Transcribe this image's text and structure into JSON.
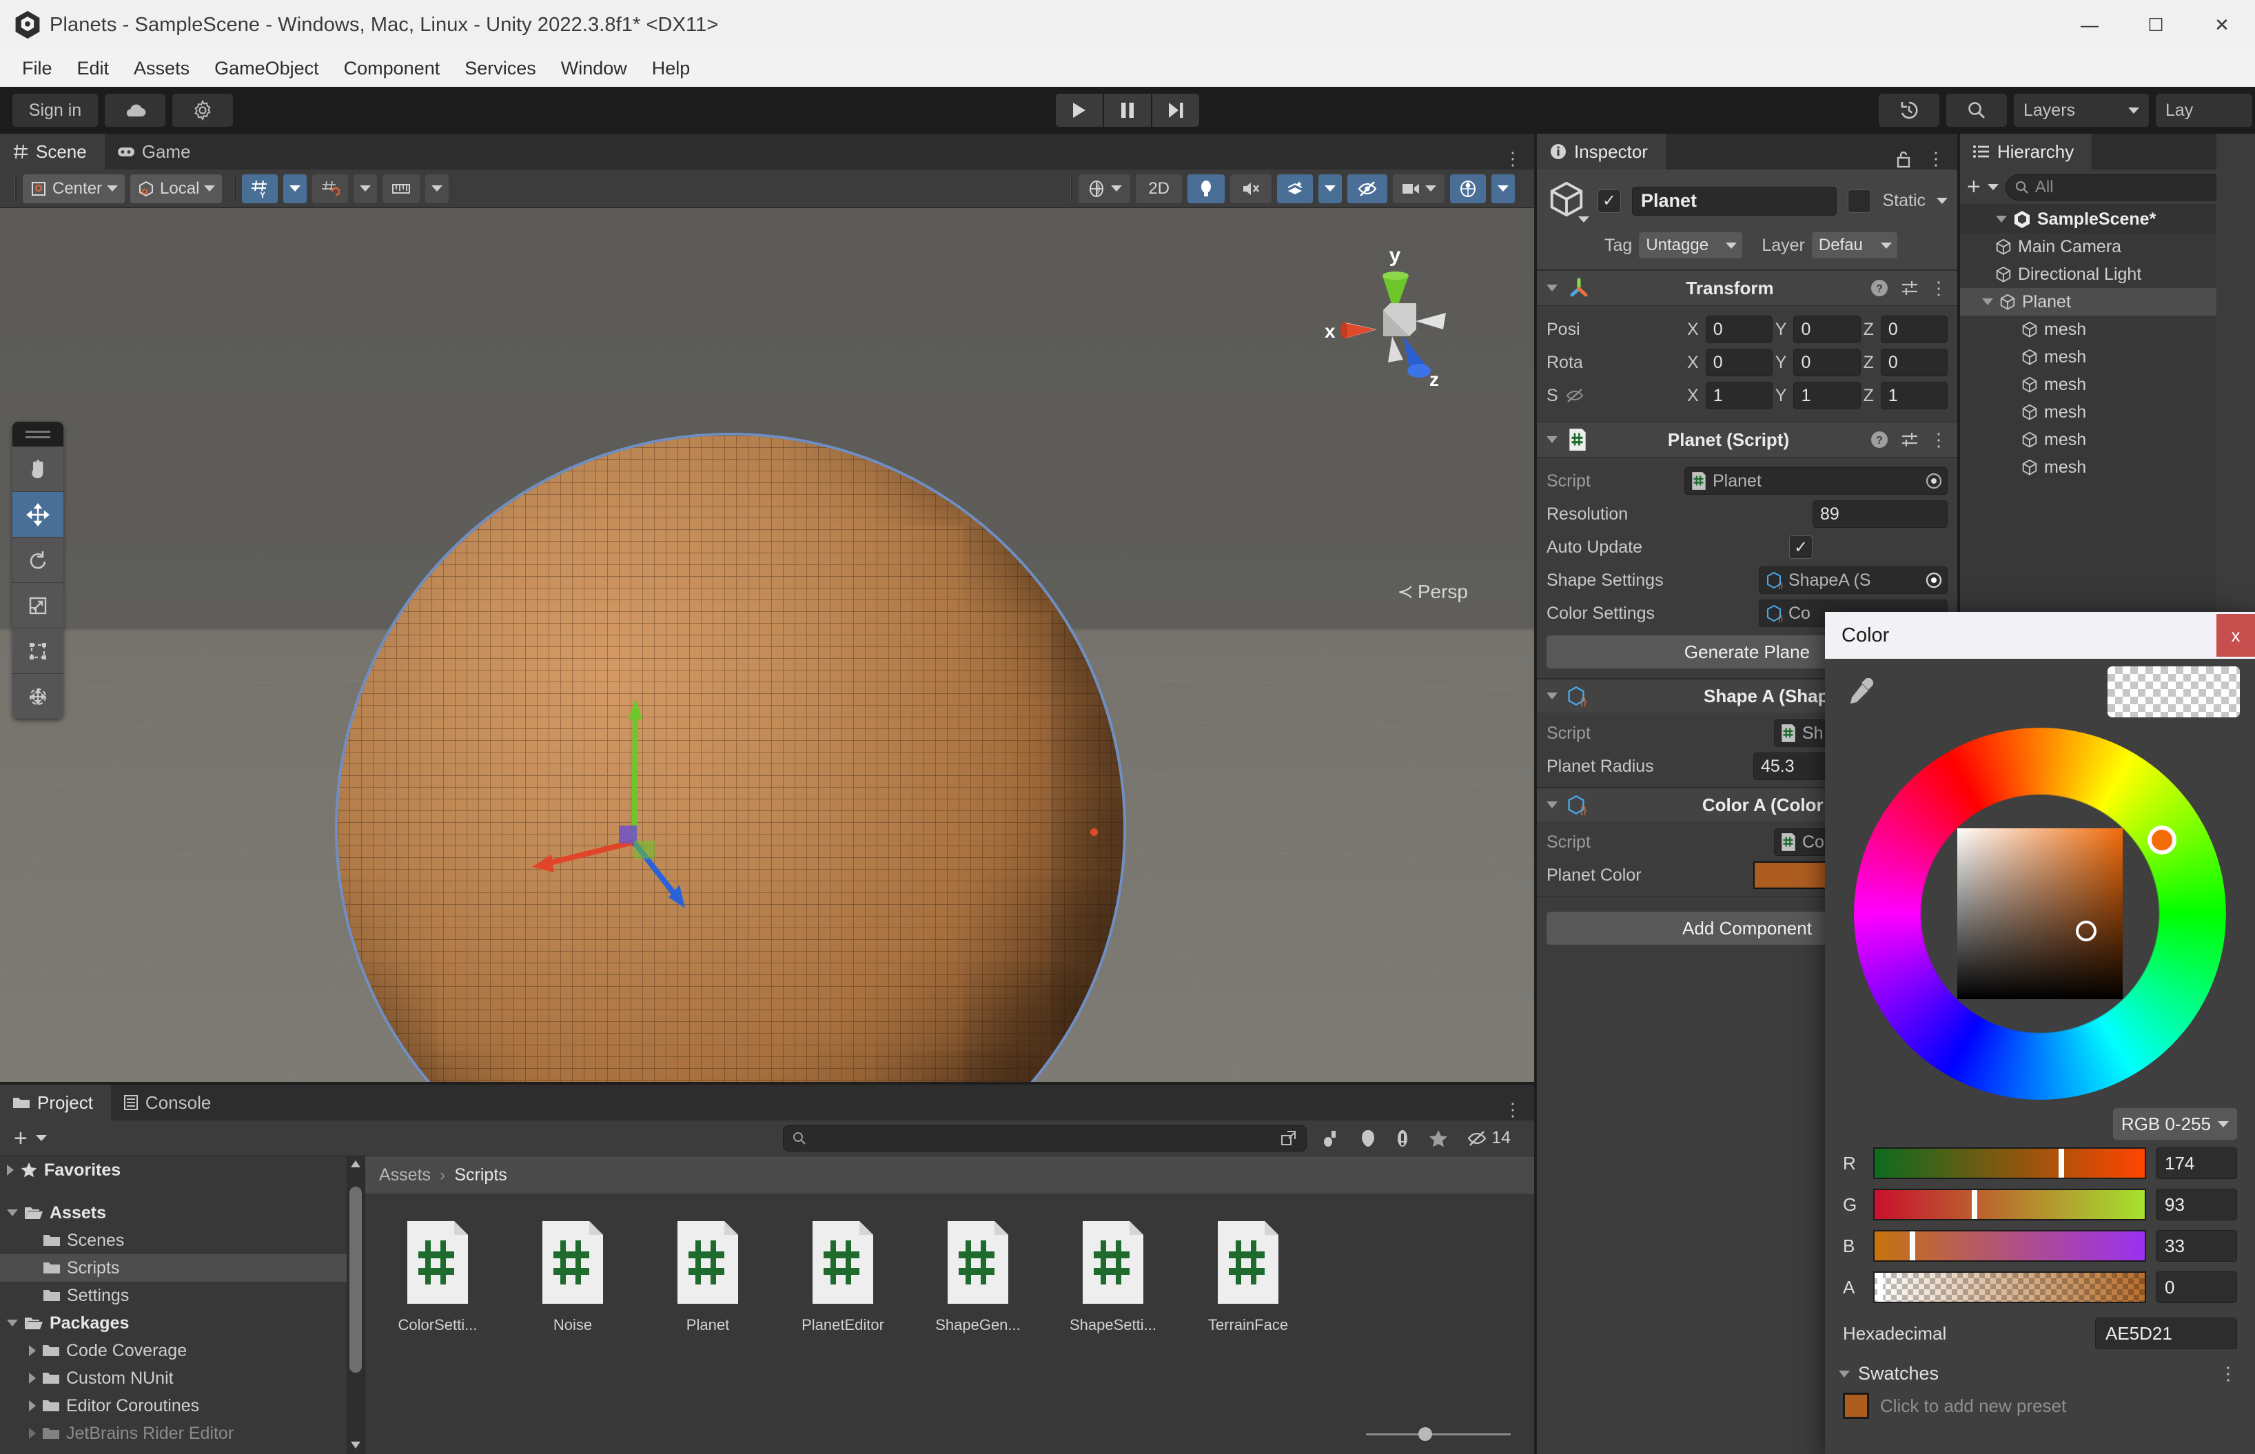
{
  "window": {
    "title": "Planets - SampleScene - Windows, Mac, Linux - Unity 2022.3.8f1* <DX11>",
    "minimize": "—",
    "maximize": "☐",
    "close": "✕"
  },
  "menubar": {
    "items": [
      "File",
      "Edit",
      "Assets",
      "GameObject",
      "Component",
      "Services",
      "Window",
      "Help"
    ]
  },
  "toolbar": {
    "signin_label": "Sign in",
    "cloud_icon": "cloud-icon",
    "settings_icon": "gear-icon",
    "play_icon": "play-icon",
    "pause_icon": "pause-icon",
    "step_icon": "step-icon",
    "history_icon": "undo-history-icon",
    "search_icon": "search-icon",
    "layers_label": "Layers",
    "layout_label": "Lay"
  },
  "scene_panel": {
    "tabs": [
      {
        "label": "Scene",
        "icon": "scene-grid-icon",
        "active": true
      },
      {
        "label": "Game",
        "icon": "gamepad-icon",
        "active": false
      }
    ],
    "toolbar": {
      "pivot_label": "Center",
      "pivot_icon": "pivot-center-icon",
      "space_label": "Local",
      "space_icon": "local-space-icon",
      "grid_icon": "grid-y-icon",
      "snap_icon": "snap-increment-icon",
      "ruler_icon": "grid-snap-ruler-icon",
      "shading_icon": "shading-mode-icon",
      "mode_2d_label": "2D",
      "lighting_icon": "lighting-icon",
      "audio_icon": "audio-mute-icon",
      "fx_icon": "effects-icon",
      "hidden_icon": "hidden-objects-icon",
      "camera_icon": "scene-camera-icon",
      "gizmos_icon": "gizmos-icon"
    },
    "left_tools": [
      {
        "name": "hand-tool",
        "selected": false
      },
      {
        "name": "move-tool",
        "selected": true
      },
      {
        "name": "rotate-tool",
        "selected": false
      },
      {
        "name": "scale-tool",
        "selected": false
      },
      {
        "name": "rect-tool",
        "selected": false
      },
      {
        "name": "transform-tool",
        "selected": false
      }
    ],
    "gizmo": {
      "x_label": "x",
      "y_label": "y",
      "z_label": "z",
      "persp_label": "Persp"
    }
  },
  "project_panel": {
    "tabs": [
      {
        "label": "Project",
        "icon": "folder-icon",
        "active": true
      },
      {
        "label": "Console",
        "icon": "console-icon",
        "active": false
      }
    ],
    "add_label": "+",
    "search_placeholder": "",
    "hidden_count": "14",
    "tree": [
      {
        "label": "Favorites",
        "depth": 0,
        "arrow": "right",
        "icon": "star-icon",
        "bold": true,
        "selected": false
      },
      {
        "label": "Assets",
        "depth": 0,
        "arrow": "down",
        "icon": "folder-open-icon",
        "bold": true,
        "selected": false
      },
      {
        "label": "Scenes",
        "depth": 1,
        "arrow": "none",
        "icon": "folder-icon",
        "bold": false,
        "selected": false
      },
      {
        "label": "Scripts",
        "depth": 1,
        "arrow": "none",
        "icon": "folder-icon",
        "bold": false,
        "selected": true
      },
      {
        "label": "Settings",
        "depth": 1,
        "arrow": "none",
        "icon": "folder-icon",
        "bold": false,
        "selected": false
      },
      {
        "label": "Packages",
        "depth": 0,
        "arrow": "down",
        "icon": "folder-open-icon",
        "bold": true,
        "selected": false
      },
      {
        "label": "Code Coverage",
        "depth": 1,
        "arrow": "right",
        "icon": "folder-icon",
        "bold": false,
        "selected": false
      },
      {
        "label": "Custom NUnit",
        "depth": 1,
        "arrow": "right",
        "icon": "folder-icon",
        "bold": false,
        "selected": false
      },
      {
        "label": "Editor Coroutines",
        "depth": 1,
        "arrow": "right",
        "icon": "folder-icon",
        "bold": false,
        "selected": false
      },
      {
        "label": "JetBrains Rider Editor",
        "depth": 1,
        "arrow": "right",
        "icon": "folder-icon",
        "bold": false,
        "selected": false
      }
    ],
    "breadcrumb": [
      "Assets",
      "Scripts"
    ],
    "assets": [
      {
        "label": "ColorSetti...",
        "icon": "csharp-script-icon"
      },
      {
        "label": "Noise",
        "icon": "csharp-script-icon"
      },
      {
        "label": "Planet",
        "icon": "csharp-script-icon"
      },
      {
        "label": "PlanetEditor",
        "icon": "csharp-script-icon"
      },
      {
        "label": "ShapeGen...",
        "icon": "csharp-script-icon"
      },
      {
        "label": "ShapeSetti...",
        "icon": "csharp-script-icon"
      },
      {
        "label": "TerrainFace",
        "icon": "csharp-script-icon"
      }
    ]
  },
  "inspector": {
    "tab_label": "Inspector",
    "tab_icon": "info-icon",
    "lock_icon": "lock-icon",
    "object": {
      "icon": "gameobject-cube-icon",
      "enabled": true,
      "name": "Planet",
      "static_label": "Static",
      "tag_label": "Tag",
      "tag_value": "Untagge",
      "layer_label": "Layer",
      "layer_value": "Defau"
    },
    "transform": {
      "title": "Transform",
      "icon": "transform-axes-icon",
      "rows": [
        {
          "label": "Posi",
          "x": "0",
          "y": "0",
          "z": "0"
        },
        {
          "label": "Rota",
          "x": "0",
          "y": "0",
          "z": "0"
        },
        {
          "label": "S",
          "x": "1",
          "y": "1",
          "z": "1"
        }
      ],
      "axis_x": "X",
      "axis_y": "Y",
      "axis_z": "Z"
    },
    "planet_script": {
      "title": "Planet (Script)",
      "icon": "csharp-script-icon",
      "script_label": "Script",
      "script_value": "Planet",
      "resolution_label": "Resolution",
      "resolution_value": "89",
      "auto_update_label": "Auto Update",
      "auto_update_checked": true,
      "shape_settings_label": "Shape Settings",
      "shape_settings_value": "ShapeA (S",
      "color_settings_label": "Color Settings",
      "color_settings_value": "Co",
      "generate_label": "Generate Plane"
    },
    "shape_a": {
      "title": "Shape A (Shape",
      "script_label": "Script",
      "script_value": "Sh",
      "radius_label": "Planet Radius",
      "radius_value": "45.3"
    },
    "color_a": {
      "title": "Color A (Color S",
      "script_label": "Script",
      "script_value": "Co",
      "color_label": "Planet Color",
      "color_value": "#AE5D21"
    },
    "add_component_label": "Add Component"
  },
  "hierarchy": {
    "tab_label": "Hierarchy",
    "tab_icon": "hierarchy-list-icon",
    "add_label": "+",
    "search_placeholder": "All",
    "rows": [
      {
        "label": "SampleScene*",
        "depth": 0,
        "arrow": "down",
        "icon": "unity-scene-icon",
        "bold": true,
        "selected": false,
        "scene": true
      },
      {
        "label": "Main Camera",
        "depth": 1,
        "arrow": "none",
        "icon": "gameobject-cube-icon",
        "bold": false,
        "selected": false
      },
      {
        "label": "Directional Light",
        "depth": 1,
        "arrow": "none",
        "icon": "gameobject-cube-icon",
        "bold": false,
        "selected": false
      },
      {
        "label": "Planet",
        "depth": 1,
        "arrow": "down",
        "icon": "gameobject-cube-icon",
        "bold": false,
        "selected": true
      },
      {
        "label": "mesh",
        "depth": 2,
        "arrow": "none",
        "icon": "gameobject-cube-icon",
        "bold": false,
        "selected": false
      },
      {
        "label": "mesh",
        "depth": 2,
        "arrow": "none",
        "icon": "gameobject-cube-icon",
        "bold": false,
        "selected": false
      },
      {
        "label": "mesh",
        "depth": 2,
        "arrow": "none",
        "icon": "gameobject-cube-icon",
        "bold": false,
        "selected": false
      },
      {
        "label": "mesh",
        "depth": 2,
        "arrow": "none",
        "icon": "gameobject-cube-icon",
        "bold": false,
        "selected": false
      },
      {
        "label": "mesh",
        "depth": 2,
        "arrow": "none",
        "icon": "gameobject-cube-icon",
        "bold": false,
        "selected": false
      },
      {
        "label": "mesh",
        "depth": 2,
        "arrow": "none",
        "icon": "gameobject-cube-icon",
        "bold": false,
        "selected": false
      }
    ]
  },
  "color_picker": {
    "title": "Color",
    "close_label": "x",
    "eyedropper_icon": "eyedropper-icon",
    "mode_label": "RGB 0-255",
    "channels": [
      {
        "label": "R",
        "value": "174",
        "pct": 68,
        "from": "#0d6b1f",
        "to": "#ff4500"
      },
      {
        "label": "G",
        "value": "93",
        "pct": 36,
        "from": "#c8102e",
        "to": "#a6e22e"
      },
      {
        "label": "B",
        "value": "33",
        "pct": 13,
        "from": "#c6740d",
        "to": "#9b30f0"
      },
      {
        "label": "A",
        "value": "0",
        "pct": 1,
        "from": "#ffffff",
        "to": "#b86f2c"
      }
    ],
    "hex_label": "Hexadecimal",
    "hex_value": "AE5D21",
    "swatches_label": "Swatches",
    "swatch_hint": "Click to add new preset",
    "selected_color": "#AE5D21"
  }
}
